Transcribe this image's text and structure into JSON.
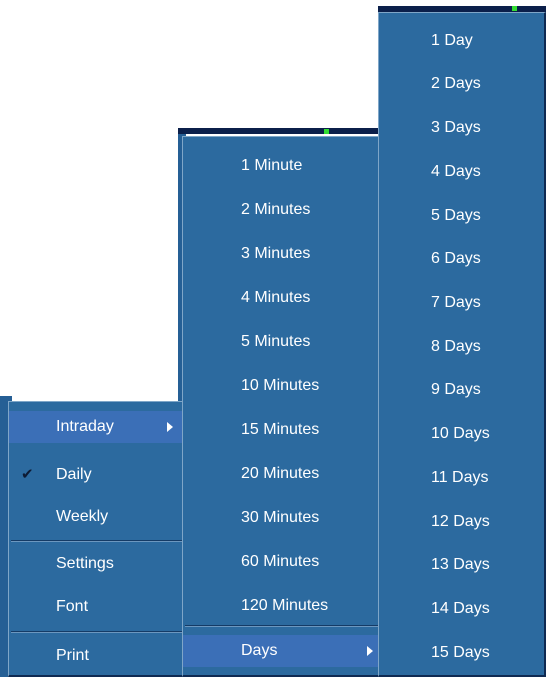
{
  "main_menu": {
    "items": [
      {
        "label": "Intraday",
        "has_submenu": true,
        "selected": true
      },
      {
        "label": "Daily",
        "checked": true
      },
      {
        "label": "Weekly"
      },
      {
        "label": "Settings"
      },
      {
        "label": "Font"
      },
      {
        "label": "Print"
      }
    ]
  },
  "intraday_menu": {
    "items": [
      {
        "label": "1 Minute"
      },
      {
        "label": "2 Minutes"
      },
      {
        "label": "3 Minutes"
      },
      {
        "label": "4 Minutes"
      },
      {
        "label": "5 Minutes"
      },
      {
        "label": "10 Minutes"
      },
      {
        "label": "15 Minutes"
      },
      {
        "label": "20 Minutes"
      },
      {
        "label": "30 Minutes"
      },
      {
        "label": "60 Minutes"
      },
      {
        "label": "120 Minutes"
      },
      {
        "label": "Days",
        "has_submenu": true,
        "selected": true
      }
    ]
  },
  "days_menu": {
    "items": [
      {
        "label": "1 Day"
      },
      {
        "label": "2 Days"
      },
      {
        "label": "3 Days"
      },
      {
        "label": "4 Days"
      },
      {
        "label": "5 Days"
      },
      {
        "label": "6 Days"
      },
      {
        "label": "7 Days"
      },
      {
        "label": "8 Days"
      },
      {
        "label": "9 Days"
      },
      {
        "label": "10 Days"
      },
      {
        "label": "11 Days"
      },
      {
        "label": "12 Days"
      },
      {
        "label": "13 Days"
      },
      {
        "label": "14 Days"
      },
      {
        "label": "15 Days"
      }
    ]
  },
  "colors": {
    "menu_bg": "#2c6a9f",
    "selected_bg": "#3b6fb7",
    "text": "#ffffff"
  },
  "icons": {
    "check": "checkmark-icon",
    "submenu": "submenu-arrow-icon"
  }
}
